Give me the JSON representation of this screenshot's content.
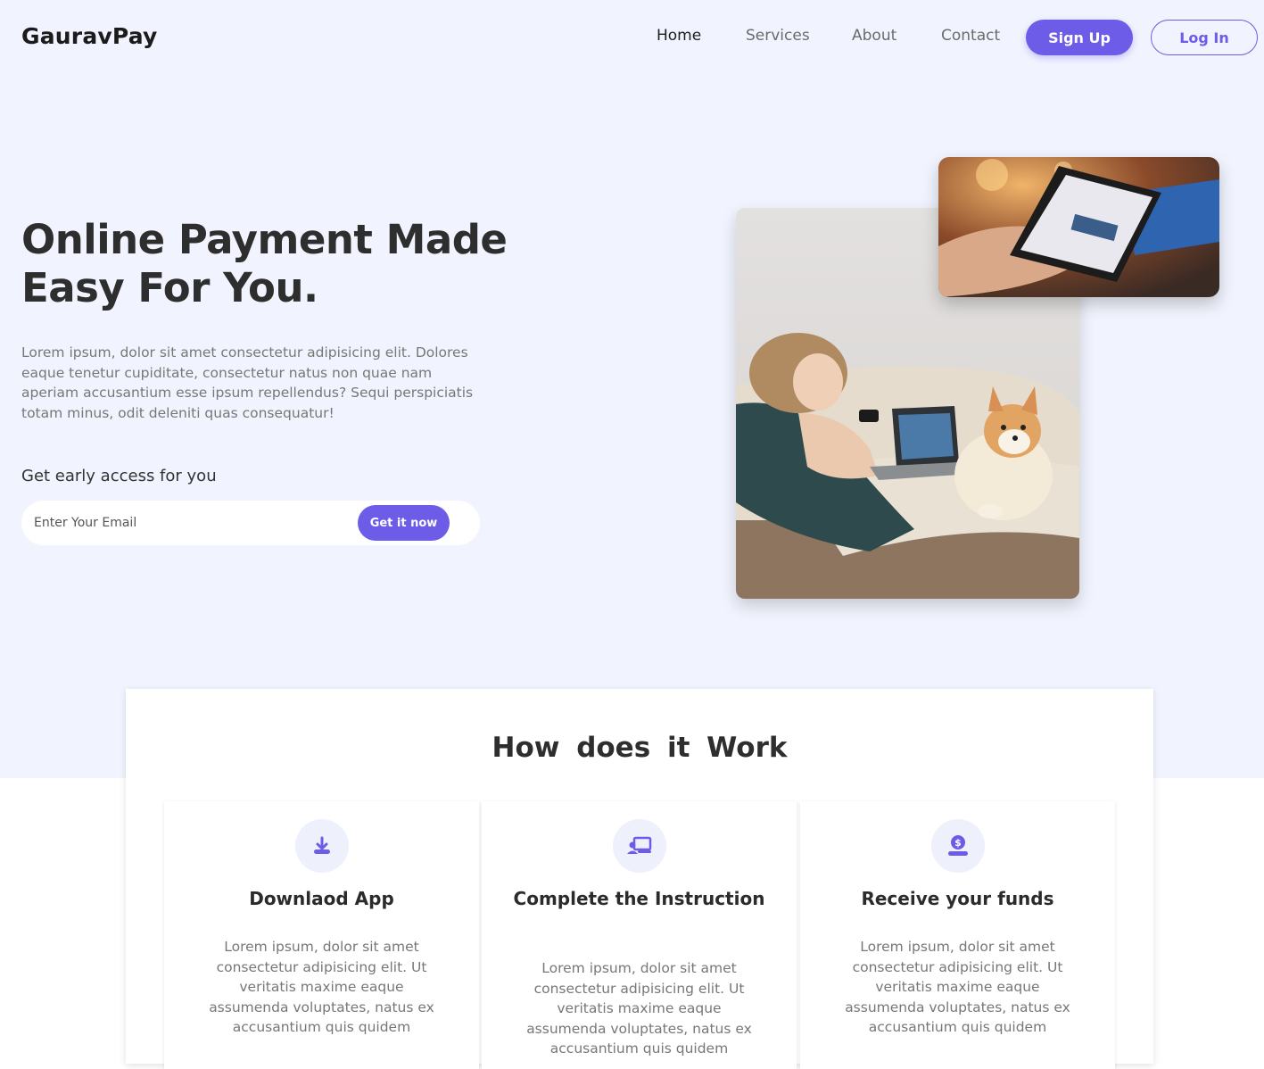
{
  "brand": "GauravPay",
  "nav": {
    "links": [
      "Home",
      "Services",
      "About",
      "Contact"
    ],
    "signup": "Sign Up",
    "login": "Log In"
  },
  "hero": {
    "title_line1": "Online Payment Made",
    "title_line2": "Easy For You.",
    "description": "Lorem ipsum, dolor sit amet consectetur adipisicing elit. Dolores eaque tenetur cupiditate, consectetur natus non quae nam aperiam accusantium esse ipsum repellendus? Sequi perspiciatis totam minus, odit deleniti quas consequatur!",
    "early_access": "Get early access for you",
    "email_placeholder": "Enter Your Email",
    "cta": "Get it now"
  },
  "works": {
    "title": "How does it Work",
    "steps": [
      {
        "icon": "download-icon",
        "title": "Downlaod App",
        "text": "Lorem ipsum, dolor sit amet consectetur adipisicing elit. Ut veritatis maxime eaque assumenda voluptates, natus ex accusantium quis quidem"
      },
      {
        "icon": "laptop-user-icon",
        "title": "Complete the Instruction",
        "text": "Lorem ipsum, dolor sit amet consectetur adipisicing elit. Ut veritatis maxime eaque assumenda voluptates, natus ex accusantium quis quidem"
      },
      {
        "icon": "money-hand-icon",
        "title": "Receive your funds",
        "text": "Lorem ipsum, dolor sit amet consectetur adipisicing elit. Ut veritatis maxime eaque assumenda voluptates, natus ex accusantium quis quidem"
      }
    ]
  },
  "colors": {
    "accent": "#6c5ce7",
    "hero_bg": "#f1f4fe"
  }
}
